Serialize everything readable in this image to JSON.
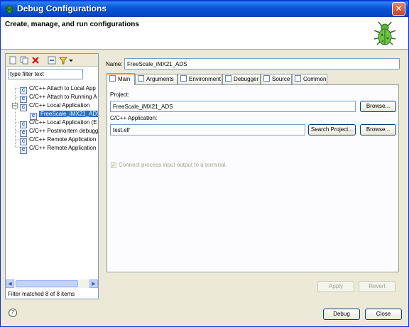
{
  "window": {
    "title": "Debug Configurations",
    "close_glyph": "✕"
  },
  "banner": {
    "title": "Create, manage, and run configurations",
    "icon": "bug-icon"
  },
  "left": {
    "toolbar_icons": [
      "new-configuration-icon",
      "duplicate-icon",
      "delete-icon",
      "collapse-all-icon",
      "filter-icon",
      "dropdown-arrow-icon"
    ],
    "filter_text": "type filter text",
    "tree": [
      {
        "label": "C/C++ Attach to Local App",
        "level": 0,
        "selected": false
      },
      {
        "label": "C/C++ Attach to Running A",
        "level": 0,
        "selected": false
      },
      {
        "label": "C/C++ Local Application",
        "level": 0,
        "selected": false,
        "expanded": true
      },
      {
        "label": "FreeScale_iMX21_ADS",
        "level": 1,
        "selected": true
      },
      {
        "label": "C/C++ Local Application (E",
        "level": 0,
        "selected": false
      },
      {
        "label": "C/C++ Postmortem debugg",
        "level": 0,
        "selected": false
      },
      {
        "label": "C/C++ Remote Application",
        "level": 0,
        "selected": false
      },
      {
        "label": "C/C++ Remote Application",
        "level": 0,
        "selected": false
      }
    ],
    "expander_glyph": "−",
    "status": "Filter matched 8 of 8 items"
  },
  "right": {
    "name_label": "Name:",
    "name_value": "FreeScale_iMX21_ADS",
    "tabs": [
      {
        "label": "Main",
        "icon": "main-tab-icon",
        "active": true
      },
      {
        "label": "Arguments",
        "icon": "arguments-icon",
        "active": false
      },
      {
        "label": "Environment",
        "icon": "environment-icon",
        "active": false
      },
      {
        "label": "Debugger",
        "icon": "debugger-icon",
        "active": false
      },
      {
        "label": "Source",
        "icon": "source-icon",
        "active": false
      },
      {
        "label": "Common",
        "icon": "common-icon",
        "active": false
      }
    ],
    "project_label": "Project:",
    "project_value": "FreeScale_iMX21_ADS",
    "browse_label": "Browse...",
    "app_label": "C/C++ Application:",
    "app_value": "test.elf",
    "search_project_label": "Search Project...",
    "browse2_label": "Browse...",
    "connect_label": "Connect process input  output to a terminal.",
    "connect_checked": true,
    "apply_label": "Apply",
    "revert_label": "Revert"
  },
  "footer": {
    "help_glyph": "?",
    "debug_label": "Debug",
    "close_label": "Close"
  },
  "colors": {
    "titlebar": "#0a58d6",
    "selection": "#316ac5",
    "active_tab_accent": "#e68b2c"
  }
}
